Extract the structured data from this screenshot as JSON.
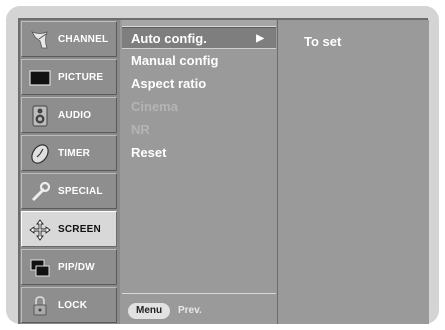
{
  "sidebar": {
    "items": [
      {
        "label": "CHANNEL",
        "icon": "satellite-dish-icon",
        "active": false
      },
      {
        "label": "PICTURE",
        "icon": "tv-screen-icon",
        "active": false
      },
      {
        "label": "AUDIO",
        "icon": "speaker-icon",
        "active": false
      },
      {
        "label": "TIMER",
        "icon": "clock-icon",
        "active": false
      },
      {
        "label": "SPECIAL",
        "icon": "wrench-icon",
        "active": false
      },
      {
        "label": "SCREEN",
        "icon": "move-arrows-icon",
        "active": true
      },
      {
        "label": "PIP/DW",
        "icon": "pip-windows-icon",
        "active": false
      },
      {
        "label": "LOCK",
        "icon": "padlock-icon",
        "active": false
      }
    ]
  },
  "menu": {
    "items": [
      {
        "label": "Auto config.",
        "state": "selected",
        "has_arrow": true
      },
      {
        "label": "Manual config",
        "state": "enabled"
      },
      {
        "label": "Aspect ratio",
        "state": "enabled"
      },
      {
        "label": "Cinema",
        "state": "disabled"
      },
      {
        "label": "NR",
        "state": "disabled"
      },
      {
        "label": "Reset",
        "state": "enabled"
      }
    ],
    "arrow_glyph": "▶",
    "footer": {
      "button_label": "Menu",
      "hint": "Prev."
    }
  },
  "submenu": {
    "label": "To set"
  },
  "colors": {
    "panel": "#9a9a9a",
    "sidebar_active": "#d8d8d8",
    "text": "#ffffff",
    "disabled_text": "#b4b4b4"
  }
}
